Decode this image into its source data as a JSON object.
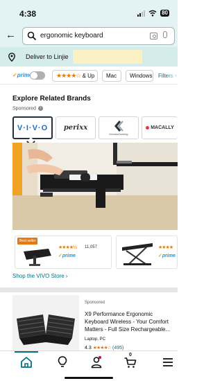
{
  "status_bar": {
    "time": "4:38",
    "battery": "80"
  },
  "search": {
    "query": "ergonomic keyboard"
  },
  "delivery": {
    "text": "Deliver to Linjie"
  },
  "filters": {
    "prime_label": "prime",
    "stars_label": "& Up",
    "chips": [
      "Mac",
      "Windows"
    ],
    "filters_label": "Filters"
  },
  "related_brands": {
    "title": "Explore Related Brands",
    "sponsored": "Sponsored",
    "brands": [
      {
        "name": "vivo",
        "logo_text": "V·I·V·O"
      },
      {
        "name": "perixx",
        "logo_text": "perixx"
      },
      {
        "name": "kinesis",
        "logo_text": "KinesisGaming"
      },
      {
        "name": "macally",
        "logo_text": "MACALLY"
      }
    ],
    "best_seller": "Best seller",
    "mini_products": [
      {
        "rating_count": "11,057",
        "prime": "prime",
        "rating": 4.5
      },
      {
        "prime": "prime",
        "rating": 4.5
      }
    ],
    "shop_link": "Shop the VIVO Store ›"
  },
  "product": {
    "sponsored": "Sponsored",
    "title": "X9 Performance Ergonomic Keyboard Wireless - Your Comfort Matters - Full Size Rechargeable...",
    "subtitle": "Laptop, PC",
    "rating": "4.3",
    "rating_count": "(495)"
  },
  "colors": {
    "header_bg": "#e3f3f3",
    "deliver_bg": "#d4ecec",
    "link": "#007185",
    "prime": "#2a8fd6",
    "star": "#e47911"
  },
  "bottom_nav": {
    "items": [
      "home-icon",
      "lightbulb-icon",
      "account-icon",
      "cart-icon",
      "menu-icon"
    ],
    "cart_count": "0"
  }
}
